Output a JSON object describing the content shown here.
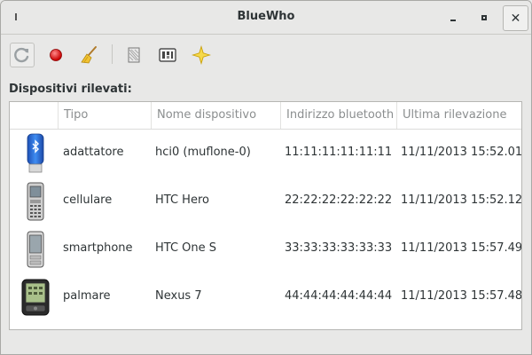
{
  "window": {
    "title": "BlueWho",
    "close_glyph": "✕"
  },
  "toolbar": {
    "buttons": [
      {
        "name": "refresh-icon"
      },
      {
        "name": "record-icon",
        "color": "#e01010"
      },
      {
        "name": "broom-icon"
      },
      {
        "name": "preferences-icon"
      },
      {
        "name": "services-icon"
      },
      {
        "name": "about-star-icon",
        "color": "#f0d23a"
      }
    ]
  },
  "main": {
    "section_label": "Dispositivi rilevati:",
    "columns": [
      "",
      "Tipo",
      "Nome dispositivo",
      "Indirizzo bluetooth",
      "Ultima rilevazione"
    ],
    "rows": [
      {
        "icon": "bluetooth-adapter-icon",
        "tipo": "adattatore",
        "nome": "hci0 (muflone-0)",
        "indirizzo": "11:11:11:11:11:11",
        "ultima": "11/11/2013 15:52.01"
      },
      {
        "icon": "mobile-phone-icon",
        "tipo": "cellulare",
        "nome": "HTC Hero",
        "indirizzo": "22:22:22:22:22:22",
        "ultima": "11/11/2013 15:52.12"
      },
      {
        "icon": "smartphone-icon",
        "tipo": "smartphone",
        "nome": "HTC One S",
        "indirizzo": "33:33:33:33:33:33",
        "ultima": "11/11/2013 15:57.49"
      },
      {
        "icon": "palmtop-icon",
        "tipo": "palmare",
        "nome": "Nexus 7",
        "indirizzo": "44:44:44:44:44:44",
        "ultima": "11/11/2013 15:57.48"
      }
    ]
  }
}
